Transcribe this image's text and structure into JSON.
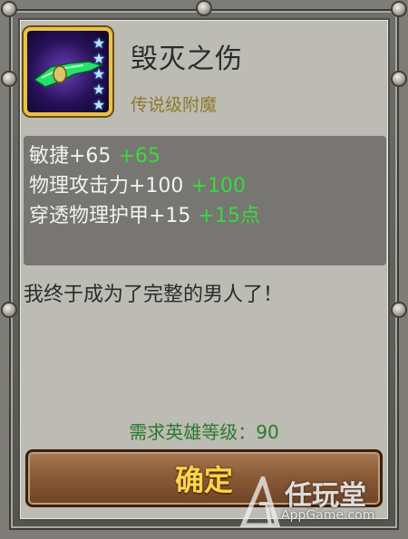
{
  "item": {
    "name": "毁灭之伤",
    "grade": "传说级附魔",
    "stars": 5,
    "icon": "green-blade-icon"
  },
  "stats": [
    {
      "base": "敏捷+65",
      "bonus": "+65"
    },
    {
      "base": "物理攻击力+100",
      "bonus": "+100"
    },
    {
      "base": "穿透物理护甲+15",
      "bonus": "+15点"
    }
  ],
  "description": "我终于成为了完整的男人了！",
  "requirement": "需求英雄等级：90",
  "confirm_label": "确定",
  "watermark": {
    "brand": "任玩堂",
    "url": "AppGame.com"
  },
  "colors": {
    "bonus": "#3cd83c",
    "requirement": "#2b7a2f",
    "button_text": "#ffd54a",
    "grade": "#8c7a2a"
  }
}
